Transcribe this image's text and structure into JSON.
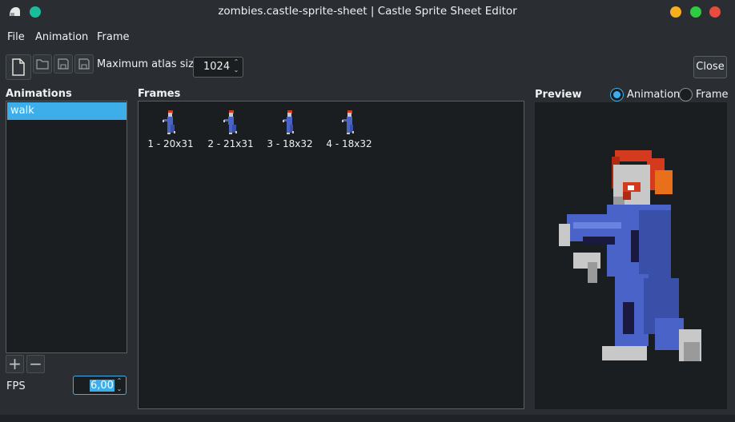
{
  "window": {
    "title": "zombies.castle-sprite-sheet | Castle Sprite Sheet Editor",
    "icons": {
      "app": "app-icon",
      "minimize": "minimize-icon",
      "maximize": "maximize-icon",
      "close": "close-icon"
    }
  },
  "menu": {
    "items": [
      "File",
      "Animation",
      "Frame"
    ]
  },
  "toolbar": {
    "icons": [
      "new-file-icon",
      "open-folder-icon",
      "save-icon",
      "save-as-icon"
    ],
    "atlas_label": "Maximum atlas size",
    "atlas_value": "1024",
    "close_label": "Close"
  },
  "animations": {
    "label": "Animations",
    "items": [
      "walk"
    ],
    "selected": "walk",
    "fps_label": "FPS",
    "fps_value": "6,00"
  },
  "frames": {
    "label": "Frames",
    "items": [
      {
        "label": "1 - 20x31"
      },
      {
        "label": "2 - 21x31"
      },
      {
        "label": "3 - 18x32"
      },
      {
        "label": "4 - 18x32"
      }
    ]
  },
  "preview": {
    "label": "Preview",
    "modes": [
      "Animation",
      "Frame"
    ],
    "selected_mode": "Animation"
  },
  "colors": {
    "accent": "#3daee9",
    "zombie_blue": "#4a63c8",
    "zombie_hair": "#d43a1e",
    "zombie_skin": "#c8c8c8"
  }
}
